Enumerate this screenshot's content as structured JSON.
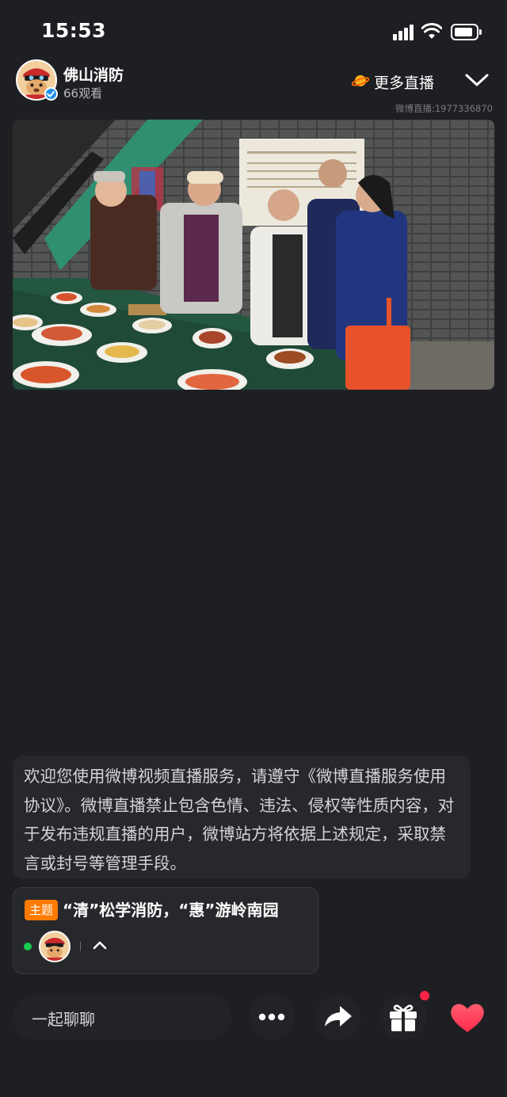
{
  "status_bar": {
    "time": "15:53",
    "battery_level": 0.8
  },
  "header": {
    "host_name": "佛山消防",
    "viewer_count": "66观看",
    "more_live_label": "更多直播",
    "live_id": "微博直播:1977336870"
  },
  "notice": {
    "text": "欢迎您使用微博视频直播服务，请遵守《微博直播服务使用协议》。微博直播禁止包含色情、违法、侵权等性质内容，对于发布违规直播的用户，微博站方将依据上述规定，采取禁言或封号等管理手段。"
  },
  "topic": {
    "tag": "主题",
    "title": "“清”松学消防，“惠”游岭南园"
  },
  "bottom_bar": {
    "chat_placeholder": "一起聊聊"
  },
  "colors": {
    "background": "#1e1f23",
    "topic_tag": "#ff7a00",
    "online_dot": "#19c94d",
    "like_heart": "#ff3b5c",
    "notification_dot": "#ff2447"
  },
  "icons": [
    "signal-icon",
    "wifi-icon",
    "battery-icon",
    "verified-icon",
    "planet-icon",
    "chevron-down-icon",
    "chevron-up-icon",
    "more-dots-icon",
    "share-icon",
    "gift-icon",
    "heart-icon"
  ]
}
